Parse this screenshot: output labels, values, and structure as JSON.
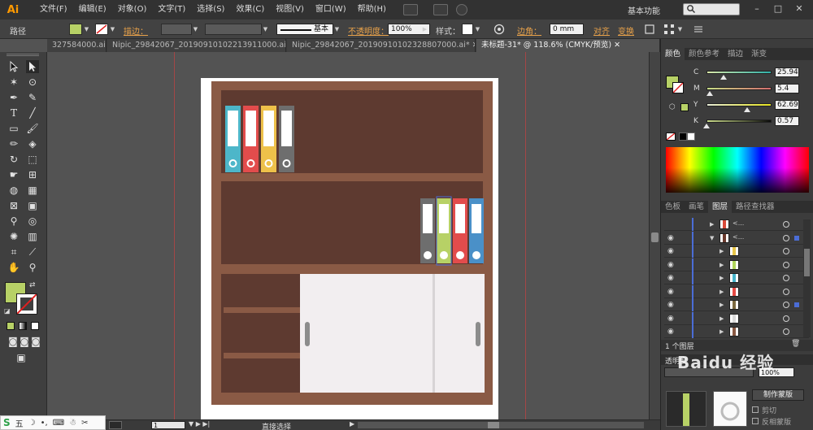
{
  "menubar": {
    "logo": "Ai",
    "items": [
      "文件(F)",
      "编辑(E)",
      "对象(O)",
      "文字(T)",
      "选择(S)",
      "效果(C)",
      "视图(V)",
      "窗口(W)",
      "帮助(H)"
    ],
    "workspace": "基本功能",
    "window_buttons": [
      "–",
      "□",
      "✕"
    ]
  },
  "controlbar": {
    "selection_label": "路径",
    "stroke_label": "描边：",
    "stroke_style": "基本",
    "opacity_label": "不透明度：",
    "opacity_value": "100%",
    "style_label": "样式：",
    "corner_label": "边角：",
    "corner_value": "0 mm",
    "align_label": "对齐",
    "transform_label": "变换",
    "fill_color": "#b7d166"
  },
  "tabs": [
    {
      "label": "327584000.ai*",
      "close": "✕"
    },
    {
      "label": "Nipic_29842067_20190910102213911000.ai*",
      "close": "✕"
    },
    {
      "label": "Nipic_29842067_20190910102328807000.ai*",
      "close": "✕"
    },
    {
      "label": "未标题-31* @ 118.6% (CMYK/预览)",
      "close": "✕"
    }
  ],
  "color_panel": {
    "tabs": [
      "颜色",
      "颜色参考",
      "描边",
      "渐变"
    ],
    "channels": [
      {
        "letter": "C",
        "value": "25.94",
        "level": 0.26
      },
      {
        "letter": "M",
        "value": "5.4",
        "level": 0.054
      },
      {
        "letter": "Y",
        "value": "62.69",
        "level": 0.63
      },
      {
        "letter": "K",
        "value": "0.57",
        "level": 0.006
      }
    ],
    "fill_color": "#b7d166"
  },
  "layers_panel": {
    "tabs": [
      "色板",
      "画笔",
      "图层",
      "路径查找器"
    ],
    "rows": [
      {
        "name": "<...",
        "expanded": false,
        "indent": 0,
        "thumb": "#d94a3a",
        "eye": false
      },
      {
        "name": "<...",
        "expanded": true,
        "indent": 0,
        "thumb": "#6b3b2e",
        "eye": true
      },
      {
        "name": "",
        "expanded": false,
        "indent": 1,
        "thumb": "#e8c64a",
        "eye": true
      },
      {
        "name": "",
        "expanded": false,
        "indent": 1,
        "thumb": "#b0d55a",
        "eye": true
      },
      {
        "name": "",
        "expanded": false,
        "indent": 1,
        "thumb": "#46b4cc",
        "eye": true
      },
      {
        "name": "",
        "expanded": false,
        "indent": 1,
        "thumb": "#e64a44",
        "eye": true
      },
      {
        "name": "",
        "expanded": false,
        "indent": 1,
        "thumb": "#7d6a40",
        "eye": true
      },
      {
        "name": "",
        "expanded": false,
        "indent": 1,
        "thumb": "#d9d9d9",
        "eye": true
      },
      {
        "name": "",
        "expanded": false,
        "indent": 1,
        "thumb": "#8a5a44",
        "eye": true
      }
    ],
    "layer_count": "1 个图层",
    "transparency_title": "透明度",
    "transparency_value": "100%",
    "make_mask_button": "制作蒙版",
    "clip_label": "剪切",
    "invert_mask_label": "反相蒙版",
    "watermark": "Baidu 经验"
  },
  "statusbar": {
    "zoom": "118.6%",
    "artboard_index": "1",
    "tool_name": "直接选择"
  },
  "ime": {
    "logo": "S",
    "label": "五"
  },
  "artwork": {
    "cabinet_frame": "#8a5a45",
    "cabinet_inner": "#5e3a30",
    "door_color": "#f2eef0",
    "door_shadow": "#d8d4d6",
    "handle_color": "#8c8c8c",
    "top_binders": [
      "#4db6c9",
      "#e24c4c",
      "#eec14a",
      "#6e6e6e"
    ],
    "middle_binders": [
      "#6e6e6e",
      "#b7d166",
      "#e24c4c",
      "#4a90c8"
    ]
  }
}
